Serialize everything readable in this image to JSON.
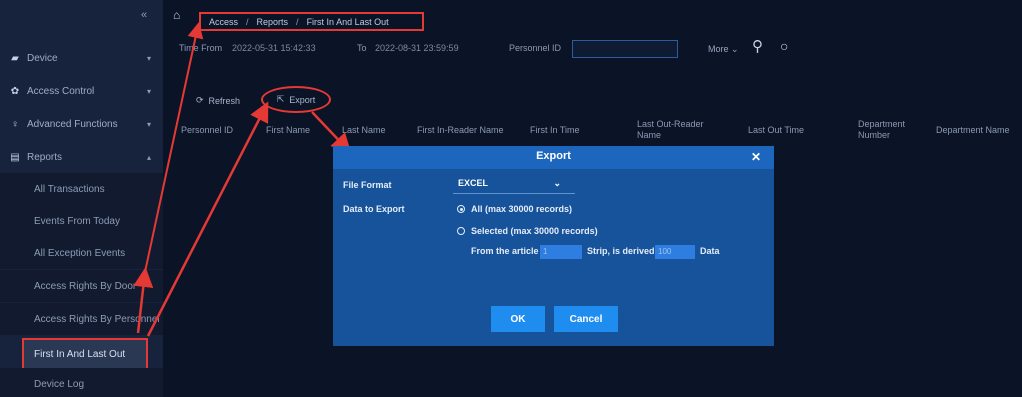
{
  "sidebar": {
    "collapse_icon": "«",
    "groups": [
      {
        "icon": "device-icon",
        "label": "Device"
      },
      {
        "icon": "access-control-icon",
        "label": "Access Control"
      },
      {
        "icon": "advanced-functions-icon",
        "label": "Advanced Functions"
      },
      {
        "icon": "reports-icon",
        "label": "Reports"
      }
    ],
    "report_items": [
      "All Transactions",
      "Events From Today",
      "All Exception Events",
      "Access Rights By Door",
      "Access Rights By Personnel",
      "First In And Last Out",
      "Device Log"
    ]
  },
  "breadcrumb": {
    "home_icon": "home-icon",
    "items": [
      "Access",
      "Reports",
      "First In And Last Out"
    ],
    "separator": "/"
  },
  "filters": {
    "time_from_label": "Time From",
    "time_from_value": "2022-05-31 15:42:33",
    "to_label": "To",
    "to_value": "2022-08-31 23:59:59",
    "personnel_id_label": "Personnel ID",
    "personnel_id_value": "",
    "more_label": "More",
    "search_icon": "search-icon",
    "reset_icon": "reset-icon"
  },
  "toolbar": {
    "refresh_label": "Refresh",
    "export_label": "Export"
  },
  "table": {
    "columns": [
      "Personnel ID",
      "First Name",
      "Last Name",
      "First In-Reader Name",
      "First In Time",
      "Last Out-Reader Name",
      "Last Out Time",
      "Department Number",
      "Department Name"
    ]
  },
  "modal": {
    "title": "Export",
    "close_icon": "close-icon",
    "file_format_label": "File Format",
    "file_format_value": "EXCEL",
    "data_to_export_label": "Data to Export",
    "options": [
      {
        "label": "All (max 30000 records)",
        "checked": true
      },
      {
        "label": "Selected (max 30000 records)",
        "checked": false
      }
    ],
    "range": {
      "from_label": "From the article",
      "from_value": "1",
      "strip_label": "Strip, is derived",
      "count_value": "100",
      "data_label": "Data"
    },
    "ok_label": "OK",
    "cancel_label": "Cancel"
  },
  "colors": {
    "annotation": "#e53935",
    "modal_bg": "#16539b",
    "button": "#1f8df0"
  }
}
